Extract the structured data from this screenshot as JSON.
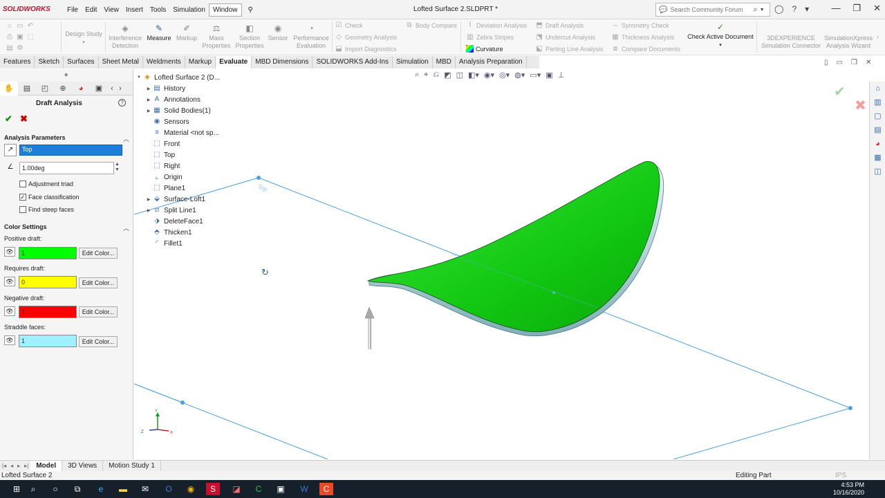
{
  "app": {
    "logo": "SOLIDWORKS",
    "menu": [
      "File",
      "Edit",
      "View",
      "Insert",
      "Tools",
      "Simulation",
      "Window"
    ],
    "active_menu": "Window",
    "doc_title": "Lofted Surface 2.SLDPRT *",
    "search_placeholder": "Search Community Forum"
  },
  "ribbon": {
    "big": [
      {
        "label": "Design Study",
        "enabled": false
      },
      {
        "label": "Interference Detection",
        "enabled": false
      },
      {
        "label": "Measure",
        "enabled": true
      },
      {
        "label": "Markup",
        "enabled": false
      },
      {
        "label": "Mass Properties",
        "enabled": false
      },
      {
        "label": "Section Properties",
        "enabled": false
      },
      {
        "label": "Sensor",
        "enabled": false
      },
      {
        "label": "Performance Evaluation",
        "enabled": false
      }
    ],
    "small_col1": [
      "Check",
      "Geometry Analysis",
      "Import Diagnostics"
    ],
    "body_compare": "Body Compare",
    "small_col2": [
      "Deviation Analysis",
      "Zebra Stripes",
      "Curvature"
    ],
    "small_col3": [
      "Draft Analysis",
      "Undercut Analysis",
      "Parting Line Analysis"
    ],
    "small_col4": [
      "Symmetry Check",
      "Thickness Analysis",
      "Compare Documents"
    ],
    "check_active": "Check Active Document",
    "experience": "3DEXPERIENCE Simulation Connector",
    "xpress": "SimulationXpress Analysis Wizard"
  },
  "tabs": [
    "Features",
    "Sketch",
    "Surfaces",
    "Sheet Metal",
    "Weldments",
    "Markup",
    "Evaluate",
    "MBD Dimensions",
    "SOLIDWORKS Add-Ins",
    "Simulation",
    "MBD",
    "Analysis Preparation"
  ],
  "active_tab": "Evaluate",
  "property": {
    "title": "Draft Analysis",
    "analysis_params_label": "Analysis Parameters",
    "direction_value": "Top",
    "angle_value": "1.00deg",
    "checkboxes": [
      {
        "label": "Adjustment triad",
        "checked": false
      },
      {
        "label": "Face classification",
        "checked": true
      },
      {
        "label": "Find steep faces",
        "checked": false
      }
    ],
    "color_settings_label": "Color Settings",
    "colors": [
      {
        "label": "Positive draft:",
        "value": "1",
        "color": "#00ff00"
      },
      {
        "label": "Requires draft:",
        "value": "0",
        "color": "#ffff00"
      },
      {
        "label": "Negative draft:",
        "value": "1",
        "color": "#ff0000"
      },
      {
        "label": "Straddle faces:",
        "value": "1",
        "color": "#a0f0ff"
      }
    ],
    "edit_color_label": "Edit Color..."
  },
  "tree": [
    {
      "label": "Lofted Surface 2  (D...",
      "icon": "part-icon",
      "expand": true
    },
    {
      "label": "History",
      "icon": "history-icon",
      "expand": true
    },
    {
      "label": "Annotations",
      "icon": "annotations-icon",
      "expand": true
    },
    {
      "label": "Solid Bodies(1)",
      "icon": "solid-bodies-icon",
      "expand": true
    },
    {
      "label": "Sensors",
      "icon": "sensors-icon",
      "expand": false
    },
    {
      "label": "Material <not sp...",
      "icon": "material-icon",
      "expand": false
    },
    {
      "label": "Front",
      "icon": "plane-icon",
      "expand": false
    },
    {
      "label": "Top",
      "icon": "plane-icon",
      "expand": false
    },
    {
      "label": "Right",
      "icon": "plane-icon",
      "expand": false
    },
    {
      "label": "Origin",
      "icon": "origin-icon",
      "expand": false
    },
    {
      "label": "Plane1",
      "icon": "plane-icon",
      "expand": false
    },
    {
      "label": "Surface-Loft1",
      "icon": "loft-icon",
      "expand": true
    },
    {
      "label": "Split Line1",
      "icon": "split-line-icon",
      "expand": true
    },
    {
      "label": "DeleteFace1",
      "icon": "delete-face-icon",
      "expand": false
    },
    {
      "label": "Thicken1",
      "icon": "thicken-icon",
      "expand": false
    },
    {
      "label": "Fillet1",
      "icon": "fillet-icon",
      "expand": false
    }
  ],
  "viewport": {
    "plane_label": "Top"
  },
  "bottom_tabs": [
    "Model",
    "3D Views",
    "Motion Study 1"
  ],
  "active_bottom_tab": "Model",
  "status": {
    "left": "Lofted Surface 2",
    "mode": "Editing Part",
    "units": "IPS"
  },
  "clock": {
    "time": "4:53 PM",
    "date": "10/16/2020"
  }
}
